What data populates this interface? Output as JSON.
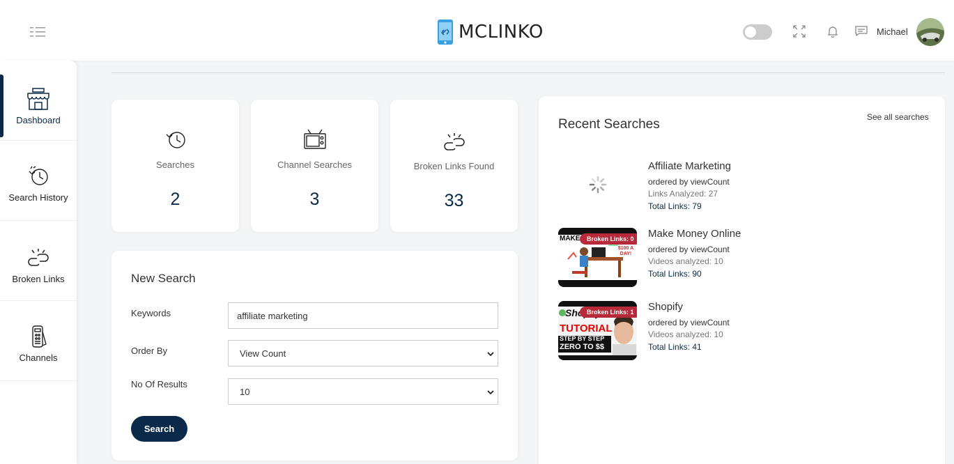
{
  "header": {
    "logo_text": "MCLINKO",
    "user_name": "Michael"
  },
  "sidebar": {
    "items": [
      {
        "label": "Dashboard",
        "icon": "store-icon",
        "active": true
      },
      {
        "label": "Search History",
        "icon": "history-icon",
        "active": false
      },
      {
        "label": "Broken Links",
        "icon": "broken-link-icon",
        "active": false
      },
      {
        "label": "Channels",
        "icon": "remote-icon",
        "active": false
      }
    ]
  },
  "stats": [
    {
      "label": "Searches",
      "value": "2",
      "icon": "history-icon"
    },
    {
      "label": "Channel Searches",
      "value": "3",
      "icon": "tv-icon"
    },
    {
      "label": "Broken Links Found",
      "value": "33",
      "icon": "broken-link-icon"
    }
  ],
  "new_search": {
    "title": "New Search",
    "keywords_label": "Keywords",
    "keywords_value": "affiliate marketing",
    "order_label": "Order By",
    "order_value": "View Count",
    "results_label": "No Of Results",
    "results_value": "10",
    "button_label": "Search"
  },
  "recent": {
    "title": "Recent Searches",
    "see_all": "See all searches",
    "items": [
      {
        "title": "Affiliate Marketing",
        "order": "ordered by viewCount",
        "analyzed": "Links Analyzed: 27",
        "total": "Total Links: 79",
        "badge": ""
      },
      {
        "title": "Make Money Online",
        "order": "ordered by viewCount",
        "analyzed": "Videos analyzed: 10",
        "total": "Total Links: 90",
        "badge": "Broken Links: 0",
        "thumb_text_1": "MAKE",
        "thumb_text_2": "$100 A DAY!"
      },
      {
        "title": "Shopify",
        "order": "ordered by viewCount",
        "analyzed": "Videos analyzed: 10",
        "total": "Total Links: 41",
        "badge": "Broken Links: 1",
        "thumb_text_1": "Shopify",
        "thumb_text_2": "TUTORIAL",
        "thumb_text_3": "STEP BY STEP",
        "thumb_text_4": "ZERO TO $$"
      }
    ]
  },
  "colors": {
    "primary": "#0b2a4a",
    "badge": "#b82a3a",
    "logo_phone": "#3aa0e0"
  }
}
